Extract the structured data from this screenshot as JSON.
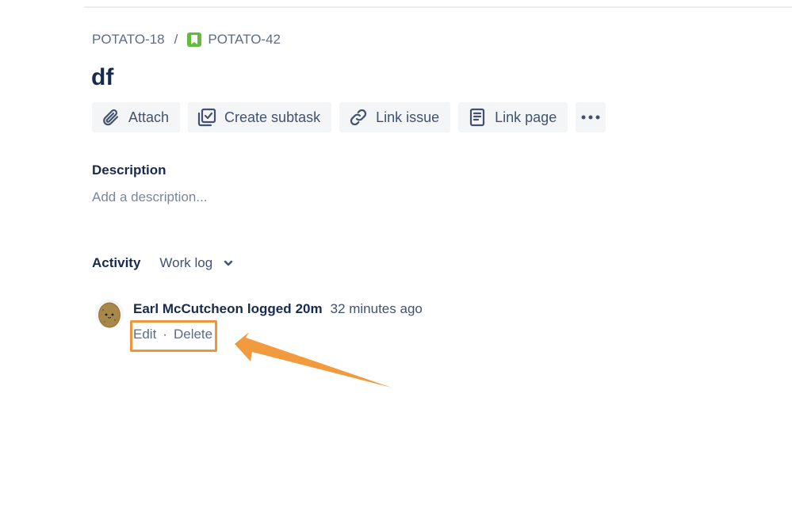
{
  "breadcrumb": {
    "parent": "POTATO-18",
    "separator": "/",
    "current": "POTATO-42"
  },
  "issue": {
    "title": "df"
  },
  "toolbar": {
    "attach": "Attach",
    "create_subtask": "Create subtask",
    "link_issue": "Link issue",
    "link_page": "Link page"
  },
  "description": {
    "label": "Description",
    "placeholder": "Add a description..."
  },
  "activity": {
    "label": "Activity",
    "filter": "Work log"
  },
  "worklog": {
    "author": "Earl McCutcheon",
    "action": "logged",
    "amount": "20m",
    "time_ago": "32 minutes ago",
    "edit": "Edit",
    "separator": "·",
    "delete": "Delete"
  },
  "colors": {
    "accent_orange": "#f0953a",
    "story_green": "#63ba3c",
    "text_primary": "#172b4d",
    "text_subtle": "#5e6c84"
  },
  "icons": {
    "story": "bookmark-icon",
    "attach": "paperclip-icon",
    "subtask": "checkbox-icon",
    "link": "link-icon",
    "page": "document-icon",
    "more": "ellipsis-icon",
    "dropdown": "chevron-down-icon"
  }
}
